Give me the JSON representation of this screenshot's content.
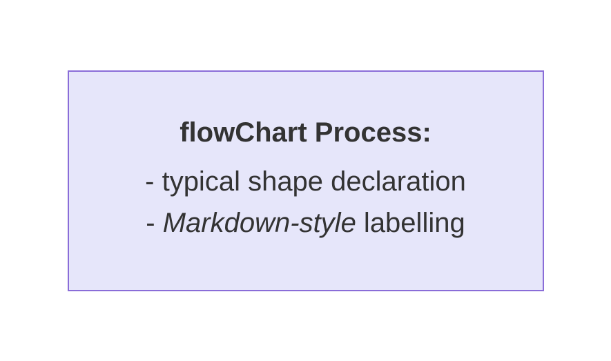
{
  "process": {
    "title": "flowChart Process:",
    "line1": "- typical shape declaration",
    "line2_prefix": "- ",
    "line2_italic": "Markdown-style",
    "line2_suffix": " labelling"
  },
  "colors": {
    "box_bg": "#e6e6fa",
    "box_border": "#8a6dd8",
    "text": "#333333"
  }
}
